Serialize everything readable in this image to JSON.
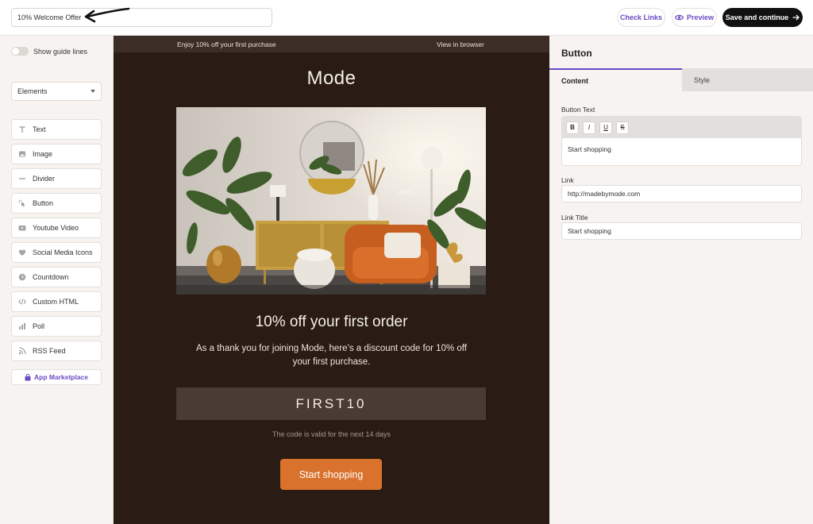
{
  "header": {
    "campaign_title": "10% Welcome Offer",
    "check_links_label": "Check Links",
    "preview_label": "Preview",
    "save_label": "Save and continue"
  },
  "sidebar": {
    "guide_lines_label": "Show guide lines",
    "elements_select": "Elements",
    "items": [
      {
        "label": "Text",
        "icon": "text-icon"
      },
      {
        "label": "Image",
        "icon": "image-icon"
      },
      {
        "label": "Divider",
        "icon": "divider-icon"
      },
      {
        "label": "Button",
        "icon": "button-icon"
      },
      {
        "label": "Youtube Video",
        "icon": "youtube-icon"
      },
      {
        "label": "Social Media Icons",
        "icon": "heart-icon"
      },
      {
        "label": "Countdown",
        "icon": "clock-icon"
      },
      {
        "label": "Custom HTML",
        "icon": "code-icon"
      },
      {
        "label": "Poll",
        "icon": "bar-chart-icon"
      },
      {
        "label": "RSS Feed",
        "icon": "rss-icon"
      }
    ],
    "marketplace_label": "App Marketplace"
  },
  "email": {
    "preheader_text": "Enjoy 10% off your first purchase",
    "view_in_browser": "View in browser",
    "brand": "Mode",
    "headline": "10% off your first order",
    "body": "As a thank you for joining Mode, here’s a discount code for 10% off your first purchase.",
    "code": "FIRST10",
    "validity": "The code is valid for the next 14 days",
    "cta_label": "Start shopping"
  },
  "panel": {
    "title": "Button",
    "tabs": [
      "Content",
      "Style"
    ],
    "button_text_label": "Button Text",
    "button_text_value": "Start shopping",
    "format_buttons": [
      "B",
      "I",
      "U",
      "S"
    ],
    "link_label": "Link",
    "link_value": "http://madebymode.com",
    "link_title_label": "Link Title",
    "link_title_value": "Start shopping"
  },
  "colors": {
    "accent": "#6a4bc4",
    "email_bg": "#2a1b14",
    "cta": "#d9722c",
    "code_bg": "#4a3b34"
  }
}
